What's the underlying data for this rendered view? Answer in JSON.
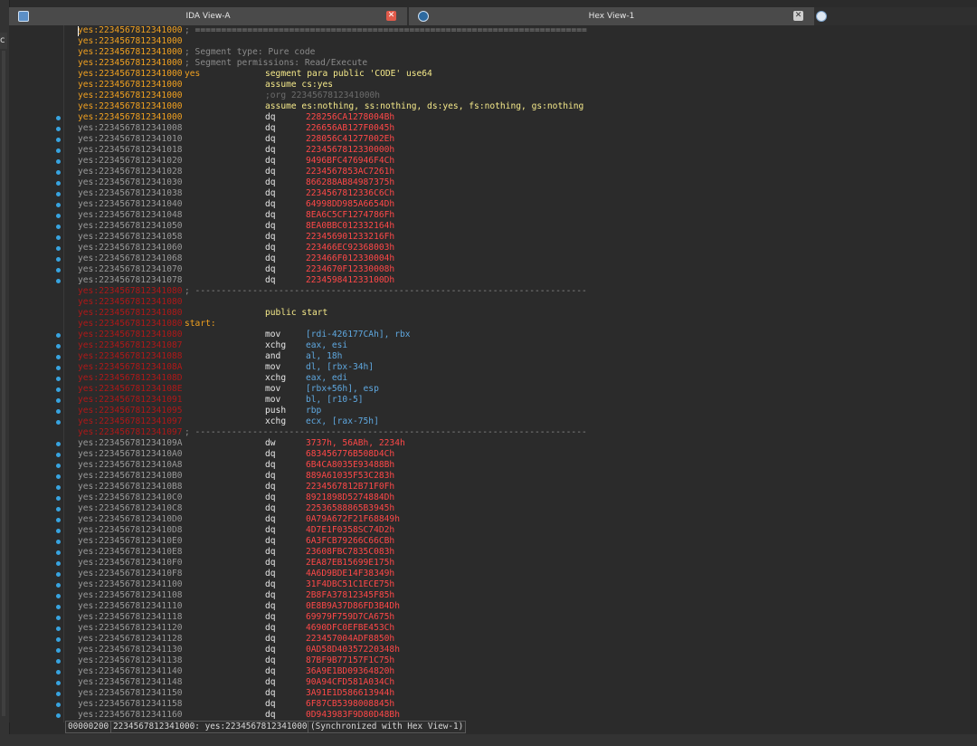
{
  "tabs": [
    {
      "label": "IDA View-A",
      "active": true
    },
    {
      "label": "Hex View-1",
      "active": false
    }
  ],
  "left_panel_fragment": "c",
  "status": {
    "offset": "00000200",
    "location": "2234567812341000: yes:2234567812341000",
    "sync": "(Synchronized with Hex View-1)"
  },
  "lines": [
    {
      "addr": "yes:2234567812341000",
      "kind": "seg",
      "cmt": "; ==========================================================================="
    },
    {
      "addr": "yes:2234567812341000",
      "kind": "seg",
      "cmt": ""
    },
    {
      "addr": "yes:2234567812341000",
      "kind": "seg",
      "cmt": "; Segment type: Pure code"
    },
    {
      "addr": "yes:2234567812341000",
      "kind": "seg",
      "cmt": "; Segment permissions: Read/Execute"
    },
    {
      "addr": "yes:2234567812341000",
      "kind": "seg",
      "lbl": "yes",
      "mn": "segment para public 'CODE' use64",
      "mnc": "dir"
    },
    {
      "addr": "yes:2234567812341000",
      "kind": "seg",
      "mn": "assume cs:yes",
      "mnc": "dir"
    },
    {
      "addr": "yes:2234567812341000",
      "kind": "seg",
      "mn": ";org 2234567812341000h",
      "mnc": "cmt2"
    },
    {
      "addr": "yes:2234567812341000",
      "kind": "seg",
      "mn": "assume es:nothing, ss:nothing, ds:yes, fs:nothing, gs:nothing",
      "mnc": "dir"
    },
    {
      "addr": "yes:2234567812341000",
      "kind": "seg",
      "mn": "dq",
      "op": "228256CA1278004Bh",
      "dot": true
    },
    {
      "addr": "yes:2234567812341008",
      "kind": "data",
      "mn": "dq",
      "op": "226656AB127F0045h",
      "dot": true
    },
    {
      "addr": "yes:2234567812341010",
      "kind": "data",
      "mn": "dq",
      "op": "228056C41277002Eh",
      "dot": true
    },
    {
      "addr": "yes:2234567812341018",
      "kind": "data",
      "mn": "dq",
      "op": "2234567812330000h",
      "dot": true
    },
    {
      "addr": "yes:2234567812341020",
      "kind": "data",
      "mn": "dq",
      "op": "9496BFC476946F4Ch",
      "dot": true
    },
    {
      "addr": "yes:2234567812341028",
      "kind": "data",
      "mn": "dq",
      "op": "2234567853AC7261h",
      "dot": true
    },
    {
      "addr": "yes:2234567812341030",
      "kind": "data",
      "mn": "dq",
      "op": "866288AB84987375h",
      "dot": true
    },
    {
      "addr": "yes:2234567812341038",
      "kind": "data",
      "mn": "dq",
      "op": "2234567812336C6Ch",
      "dot": true
    },
    {
      "addr": "yes:2234567812341040",
      "kind": "data",
      "mn": "dq",
      "op": "64998DD985A6654Dh",
      "dot": true
    },
    {
      "addr": "yes:2234567812341048",
      "kind": "data",
      "mn": "dq",
      "op": "8EA6C5CF1274786Fh",
      "dot": true
    },
    {
      "addr": "yes:2234567812341050",
      "kind": "data",
      "mn": "dq",
      "op": "8EA0BBC012332164h",
      "dot": true
    },
    {
      "addr": "yes:2234567812341058",
      "kind": "data",
      "mn": "dq",
      "op": "223456901233216Fh",
      "dot": true
    },
    {
      "addr": "yes:2234567812341060",
      "kind": "data",
      "mn": "dq",
      "op": "223466EC92368003h",
      "dot": true
    },
    {
      "addr": "yes:2234567812341068",
      "kind": "data",
      "mn": "dq",
      "op": "223466F012330004h",
      "dot": true
    },
    {
      "addr": "yes:2234567812341070",
      "kind": "data",
      "mn": "dq",
      "op": "2234670F12330008h",
      "dot": true
    },
    {
      "addr": "yes:2234567812341078",
      "kind": "data",
      "mn": "dq",
      "op": "223459841233100Dh",
      "dot": true
    },
    {
      "addr": "yes:2234567812341080",
      "kind": "code",
      "cmt": "; ---------------------------------------------------------------------------"
    },
    {
      "addr": "yes:2234567812341080",
      "kind": "code"
    },
    {
      "addr": "yes:2234567812341080",
      "kind": "code",
      "mn": "public start",
      "mnc": "dir"
    },
    {
      "addr": "yes:2234567812341080",
      "kind": "code",
      "lbl": "start:"
    },
    {
      "addr": "yes:2234567812341080",
      "kind": "code",
      "mn": "mov",
      "op": "[rdi-426177CAh], rbx",
      "opc": "code",
      "dot": true
    },
    {
      "addr": "yes:2234567812341087",
      "kind": "code",
      "mn": "xchg",
      "op": "eax, esi",
      "opc": "code",
      "dot": true
    },
    {
      "addr": "yes:2234567812341088",
      "kind": "code",
      "mn": "and",
      "op": "al, 18h",
      "opc": "code",
      "dot": true
    },
    {
      "addr": "yes:223456781234108A",
      "kind": "code",
      "mn": "mov",
      "op": "dl, [rbx-34h]",
      "opc": "code",
      "dot": true
    },
    {
      "addr": "yes:223456781234108D",
      "kind": "code",
      "mn": "xchg",
      "op": "eax, edi",
      "opc": "code",
      "dot": true
    },
    {
      "addr": "yes:223456781234108E",
      "kind": "code",
      "mn": "mov",
      "op": "[rbx+56h], esp",
      "opc": "code",
      "dot": true
    },
    {
      "addr": "yes:2234567812341091",
      "kind": "code",
      "mn": "mov",
      "op": "bl, [r10-5]",
      "opc": "code",
      "dot": true
    },
    {
      "addr": "yes:2234567812341095",
      "kind": "code",
      "mn": "push",
      "op": "rbp",
      "opc": "code",
      "dot": true
    },
    {
      "addr": "yes:2234567812341097",
      "kind": "code",
      "mn": "xchg",
      "op": "ecx, [rax-75h]",
      "opc": "code",
      "dot": true
    },
    {
      "addr": "yes:2234567812341097",
      "kind": "code",
      "cmt": "; ---------------------------------------------------------------------------"
    },
    {
      "addr": "yes:223456781234109A",
      "kind": "data",
      "mn": "dw",
      "op": "3737h, 56ABh, 2234h",
      "dot": true
    },
    {
      "addr": "yes:22345678123410A0",
      "kind": "data",
      "mn": "dq",
      "op": "683456776B508D4Ch",
      "dot": true
    },
    {
      "addr": "yes:22345678123410A8",
      "kind": "data",
      "mn": "dq",
      "op": "6B4CA8035E93488Bh",
      "dot": true
    },
    {
      "addr": "yes:22345678123410B0",
      "kind": "data",
      "mn": "dq",
      "op": "889A61035F53C283h",
      "dot": true
    },
    {
      "addr": "yes:22345678123410B8",
      "kind": "data",
      "mn": "dq",
      "op": "2234567812B71F0Fh",
      "dot": true
    },
    {
      "addr": "yes:22345678123410C0",
      "kind": "data",
      "mn": "dq",
      "op": "8921898D5274884Dh",
      "dot": true
    },
    {
      "addr": "yes:22345678123410C8",
      "kind": "data",
      "mn": "dq",
      "op": "22536588865B3945h",
      "dot": true
    },
    {
      "addr": "yes:22345678123410D0",
      "kind": "data",
      "mn": "dq",
      "op": "0A79A672F21F68849h",
      "dot": true
    },
    {
      "addr": "yes:22345678123410D8",
      "kind": "data",
      "mn": "dq",
      "op": "4D7E1F0358SC74D2h",
      "dot": true
    },
    {
      "addr": "yes:22345678123410E0",
      "kind": "data",
      "mn": "dq",
      "op": "6A3FCB79266C66CBh",
      "dot": true
    },
    {
      "addr": "yes:22345678123410E8",
      "kind": "data",
      "mn": "dq",
      "op": "23608FBC7835C083h",
      "dot": true
    },
    {
      "addr": "yes:22345678123410F0",
      "kind": "data",
      "mn": "dq",
      "op": "2EA87EB15699E175h",
      "dot": true
    },
    {
      "addr": "yes:22345678123410F8",
      "kind": "data",
      "mn": "dq",
      "op": "4A6D9BDE14F38349h",
      "dot": true
    },
    {
      "addr": "yes:2234567812341100",
      "kind": "data",
      "mn": "dq",
      "op": "31F4DBC51C1ECE75h",
      "dot": true
    },
    {
      "addr": "yes:2234567812341108",
      "kind": "data",
      "mn": "dq",
      "op": "2B8FA37812345F85h",
      "dot": true
    },
    {
      "addr": "yes:2234567812341110",
      "kind": "data",
      "mn": "dq",
      "op": "0E8B9A37D86FD3B4Dh",
      "dot": true
    },
    {
      "addr": "yes:2234567812341118",
      "kind": "data",
      "mn": "dq",
      "op": "69979F759D7CA675h",
      "dot": true
    },
    {
      "addr": "yes:2234567812341120",
      "kind": "data",
      "mn": "dq",
      "op": "4690DFC0EFBE453Ch",
      "dot": true
    },
    {
      "addr": "yes:2234567812341128",
      "kind": "data",
      "mn": "dq",
      "op": "223457004ADF8850h",
      "dot": true
    },
    {
      "addr": "yes:2234567812341130",
      "kind": "data",
      "mn": "dq",
      "op": "0AD58D40357220348h",
      "dot": true
    },
    {
      "addr": "yes:2234567812341138",
      "kind": "data",
      "mn": "dq",
      "op": "87BF9B77157F1C75h",
      "dot": true
    },
    {
      "addr": "yes:2234567812341140",
      "kind": "data",
      "mn": "dq",
      "op": "36A9E1BD09364820h",
      "dot": true
    },
    {
      "addr": "yes:2234567812341148",
      "kind": "data",
      "mn": "dq",
      "op": "90A94CFD581A034Ch",
      "dot": true
    },
    {
      "addr": "yes:2234567812341150",
      "kind": "data",
      "mn": "dq",
      "op": "3A91E1D586613944h",
      "dot": true
    },
    {
      "addr": "yes:2234567812341158",
      "kind": "data",
      "mn": "dq",
      "op": "6F87CB5398008845h",
      "dot": true
    },
    {
      "addr": "yes:2234567812341160",
      "kind": "data",
      "mn": "dq",
      "op": "0D943983F9D80D48Bh",
      "dot": true
    }
  ]
}
